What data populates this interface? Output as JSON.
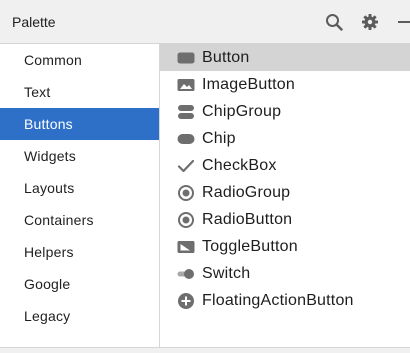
{
  "window": {
    "title": "Palette"
  },
  "header_icons": [
    "search-icon",
    "gear-icon",
    "minimize-icon"
  ],
  "colors": {
    "selected_category": "#2e6fc8",
    "selected_widget": "#d4d4d4",
    "icon_gray": "#6e6e6e"
  },
  "categories": [
    {
      "label": "Common"
    },
    {
      "label": "Text"
    },
    {
      "label": "Buttons",
      "selected": true
    },
    {
      "label": "Widgets"
    },
    {
      "label": "Layouts"
    },
    {
      "label": "Containers"
    },
    {
      "label": "Helpers"
    },
    {
      "label": "Google"
    },
    {
      "label": "Legacy"
    }
  ],
  "widgets": [
    {
      "label": "Button",
      "icon": "button-icon",
      "selected": true
    },
    {
      "label": "ImageButton",
      "icon": "image-button-icon"
    },
    {
      "label": "ChipGroup",
      "icon": "chip-group-icon"
    },
    {
      "label": "Chip",
      "icon": "chip-icon"
    },
    {
      "label": "CheckBox",
      "icon": "checkmark-icon"
    },
    {
      "label": "RadioGroup",
      "icon": "radio-group-icon"
    },
    {
      "label": "RadioButton",
      "icon": "radio-button-icon"
    },
    {
      "label": "ToggleButton",
      "icon": "toggle-button-icon"
    },
    {
      "label": "Switch",
      "icon": "switch-icon"
    },
    {
      "label": "FloatingActionButton",
      "icon": "fab-icon"
    }
  ]
}
